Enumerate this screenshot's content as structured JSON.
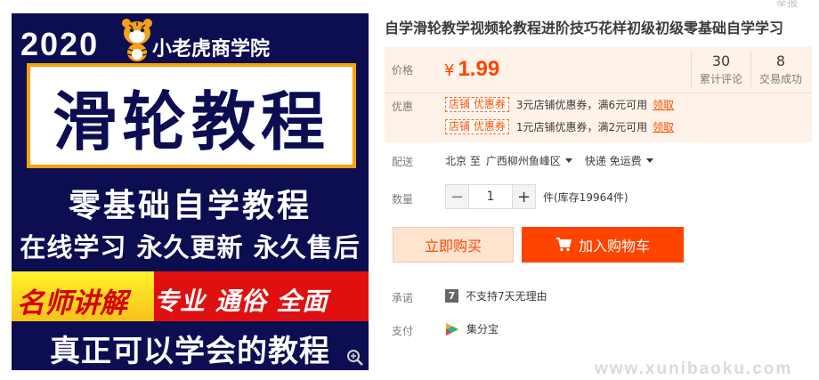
{
  "poster": {
    "year": "2020",
    "brand": "小老虎商学院",
    "main_title": "滑轮教程",
    "line1": "零基础自学教程",
    "line2": "在线学习 永久更新 永久售后",
    "band_left": "名师讲解",
    "band_right": "专业 通俗 全面",
    "line3": "真正可以学会的教程"
  },
  "product": {
    "top_cut_text": "举报",
    "title": "自学滑轮教学视频轮教程进阶技巧花样初级初级零基础自学学习"
  },
  "price": {
    "label": "价格",
    "currency": "¥",
    "value": "1.99"
  },
  "stats": [
    {
      "number": "30",
      "label": "累计评论"
    },
    {
      "number": "8",
      "label": "交易成功"
    }
  ],
  "promotion": {
    "label": "优惠",
    "coupons": [
      {
        "tag": "店铺 优惠券",
        "text": "3元店铺优惠券，满6元可用",
        "link": "领取"
      },
      {
        "tag": "店铺 优惠券",
        "text": "1元店铺优惠券，满2元可用",
        "link": "领取"
      }
    ]
  },
  "shipping": {
    "label": "配送",
    "origin": "北京 至",
    "destination": "广西柳州鱼峰区",
    "method": "快递 免运费"
  },
  "quantity": {
    "label": "数量",
    "value": "1",
    "minus": "−",
    "plus": "+",
    "stock": "件(库存19964件)"
  },
  "buttons": {
    "buy_now": "立即购买",
    "add_cart": "加入购物车"
  },
  "promise": {
    "label": "承诺",
    "badge": "7",
    "text": "不支持7天无理由"
  },
  "payment": {
    "label": "支付",
    "text": "集分宝"
  },
  "watermark": "www.xunibaoku.com",
  "colors": {
    "accent": "#ff4400",
    "poster_bg": "#0d0d52",
    "price_bg": "#fff2e8"
  }
}
